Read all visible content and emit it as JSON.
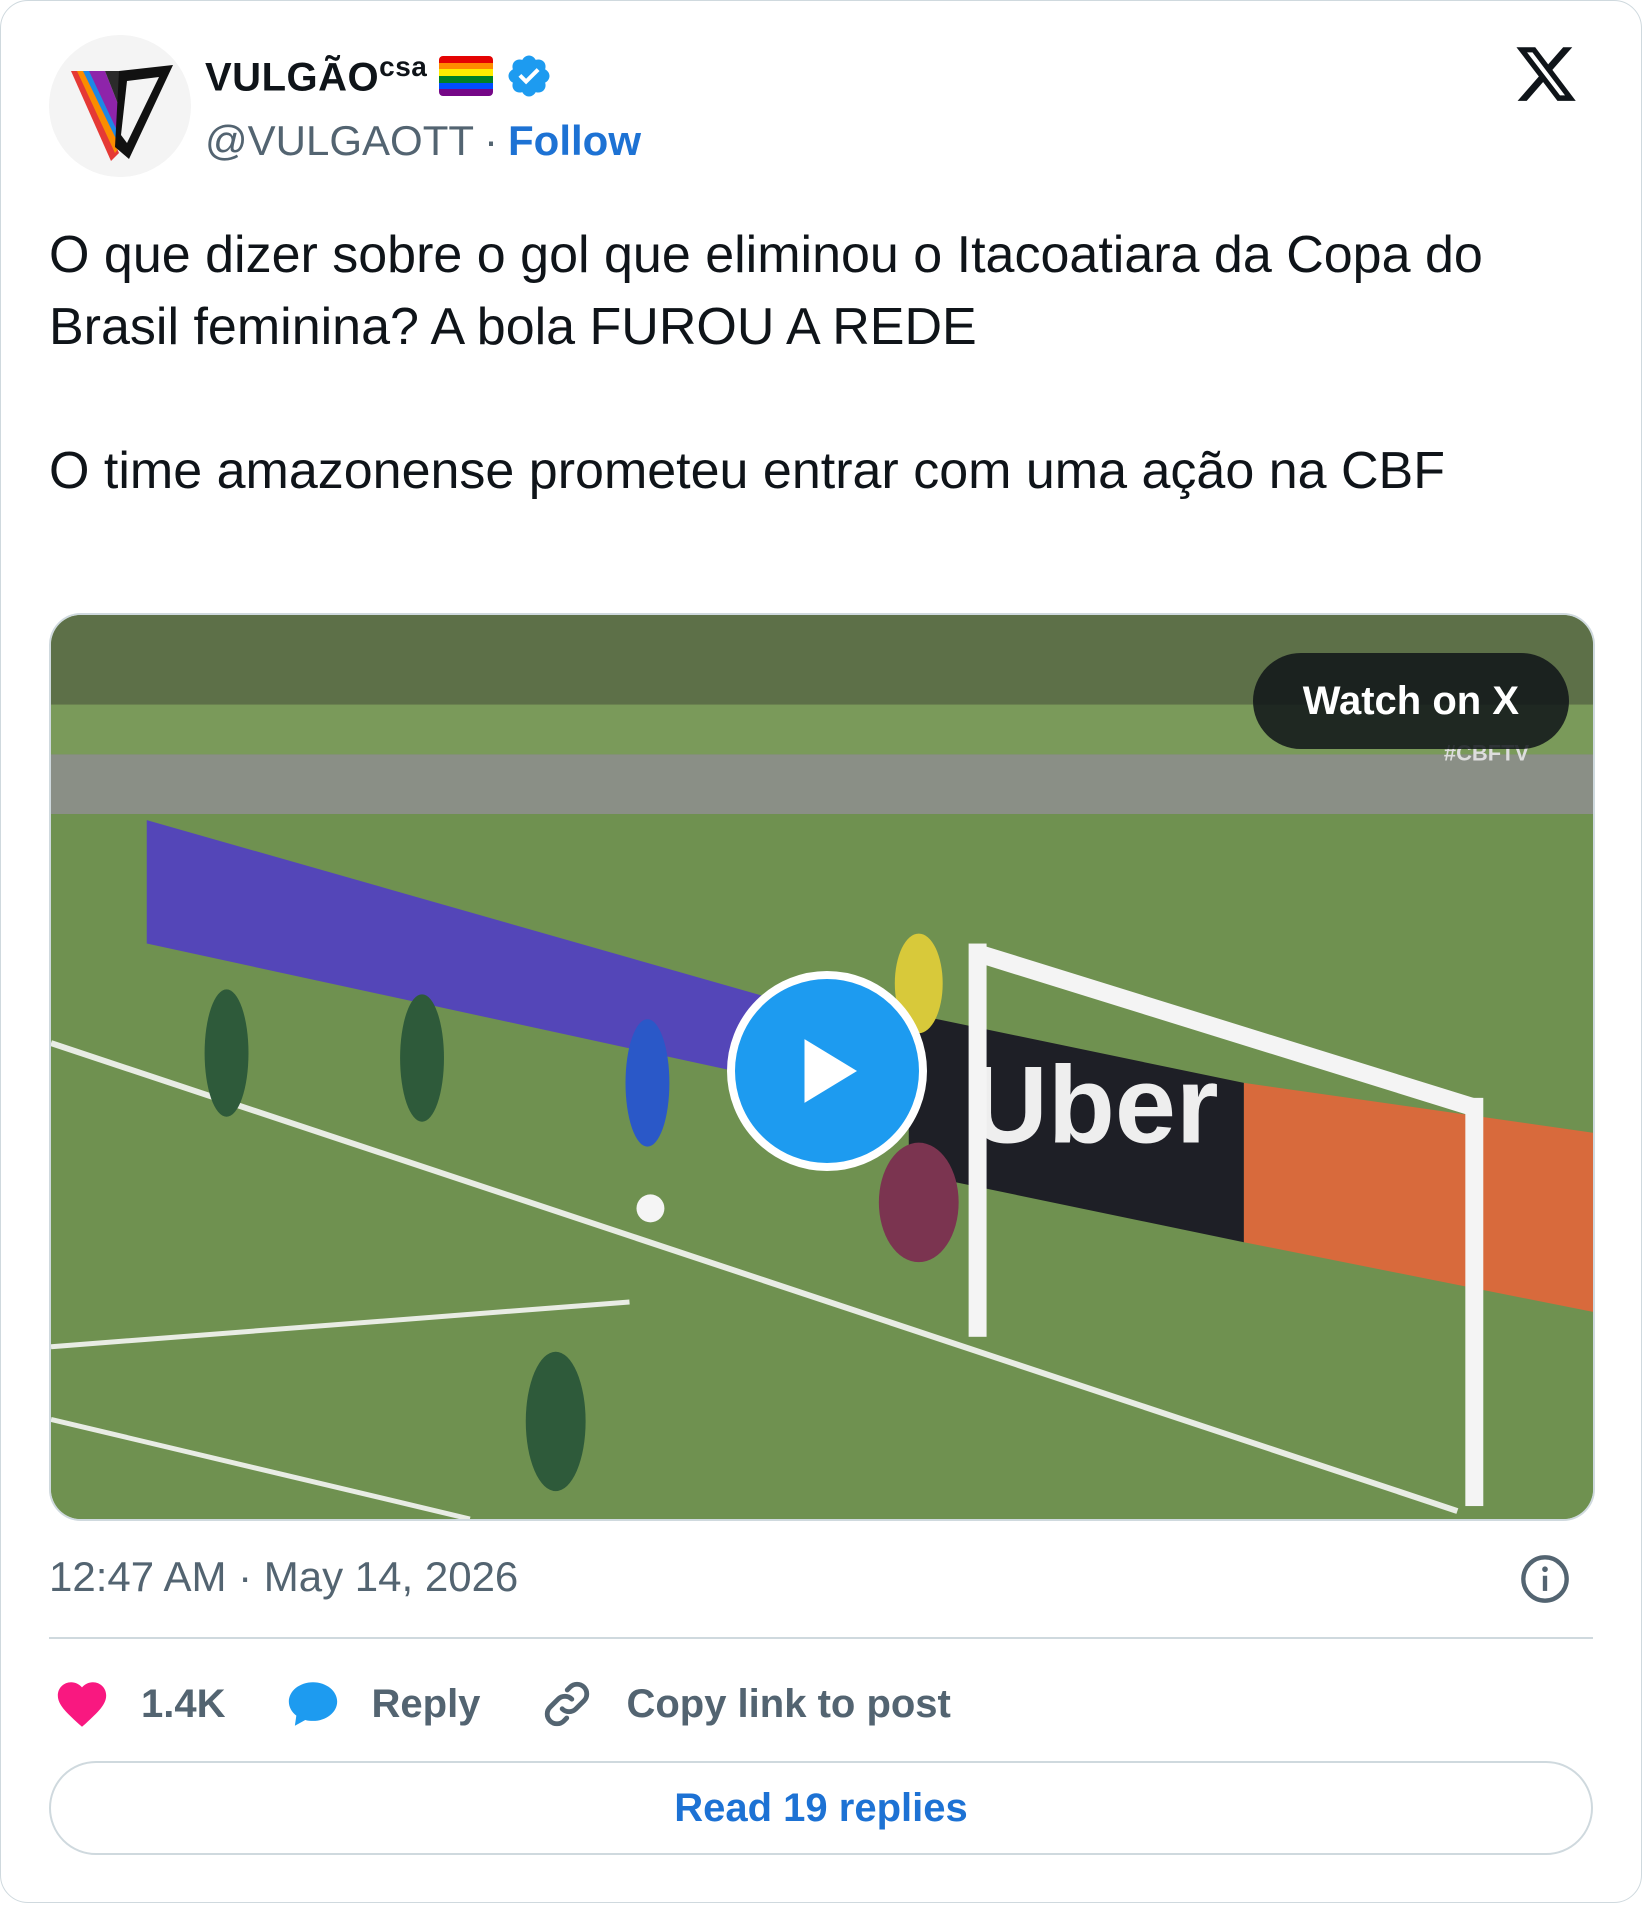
{
  "author": {
    "display_name": "VULGÃO",
    "name_suffix": "csa",
    "handle": "@VULGAOTT",
    "separator": "·",
    "follow_label": "Follow",
    "flag_icon": "rainbow-flag-icon",
    "verified_icon": "verified-badge-icon",
    "verified_color": "#1d9bf0"
  },
  "tweet": {
    "paragraph_1": "O que dizer sobre o gol que eliminou o Itacoatiara da Copa do Brasil feminina? A bola FUROU A REDE",
    "paragraph_2": "O time amazonense prometeu entrar com uma ação na CBF"
  },
  "media": {
    "watch_label": "Watch on X",
    "play_icon": "play-icon",
    "overlay_tag": "#CBFTV",
    "sponsor_text": "Uber"
  },
  "meta": {
    "timestamp": "12:47 AM · May 14, 2026",
    "info_icon": "info-icon"
  },
  "actions": {
    "likes": "1.4K",
    "reply_label": "Reply",
    "copy_label": "Copy link to post",
    "like_color": "#f91880",
    "reply_color": "#1d9bf0"
  },
  "read_replies_label": "Read 19 replies",
  "colors": {
    "link_blue": "#1d72d4",
    "secondary_text": "#536471",
    "border": "#cfd9de"
  }
}
